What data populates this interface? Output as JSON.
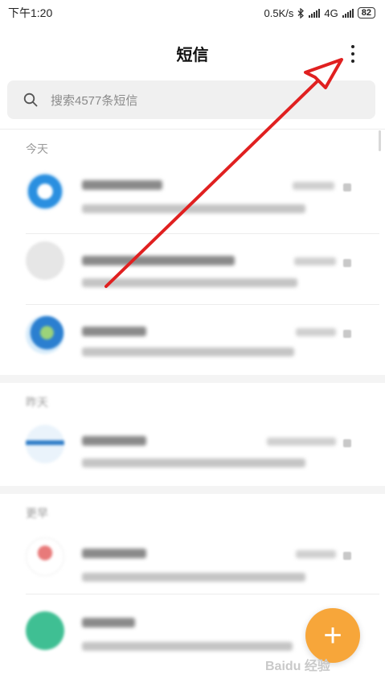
{
  "status_bar": {
    "time": "下午1:20",
    "net_speed": "0.5K/s",
    "network": "4G",
    "battery": "82"
  },
  "header": {
    "title": "短信"
  },
  "search": {
    "placeholder": "搜索4577条短信"
  },
  "sections": [
    {
      "label": "今天"
    },
    {
      "label": "昨天"
    },
    {
      "label": "更早"
    }
  ],
  "watermark": "Baidu 经验"
}
